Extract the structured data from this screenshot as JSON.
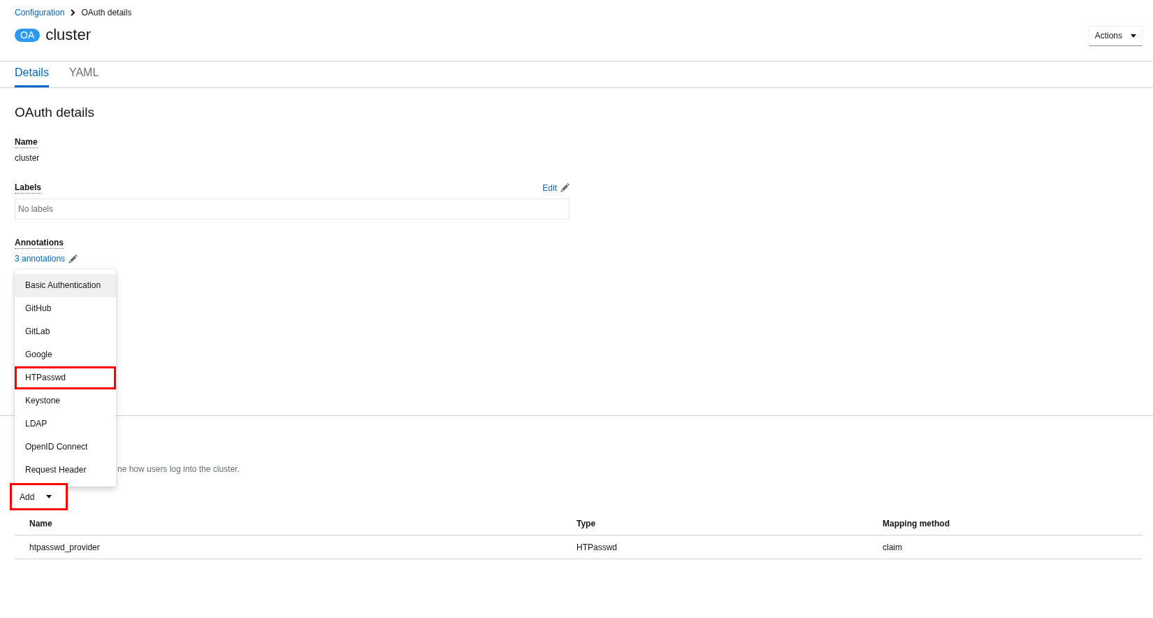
{
  "breadcrumb": [
    {
      "label": "Configuration",
      "kind": "link"
    },
    {
      "label": "OAuth details",
      "kind": "current"
    }
  ],
  "header": {
    "badge": "OA",
    "title": "cluster",
    "actions_button": "Actions"
  },
  "tabs": [
    {
      "label": "Details",
      "selected": true
    },
    {
      "label": "YAML",
      "selected": false
    }
  ],
  "details": {
    "heading": "OAuth details",
    "fields": [
      {
        "kind": "text",
        "label": "Name",
        "value": "cluster"
      },
      {
        "kind": "labels",
        "label": "Labels",
        "edit": "Edit",
        "value": "No labels"
      },
      {
        "kind": "link",
        "label": "Annotations",
        "value": "3 annotations"
      }
    ]
  },
  "identity_providers": {
    "description": "ne how users log into the cluster.",
    "add_button": {
      "label": "Add",
      "highlighted": true
    },
    "add_menu": {
      "items": [
        {
          "label": "Basic Authentication",
          "focused": true,
          "highlighted": false
        },
        {
          "label": "GitHub",
          "focused": false,
          "highlighted": false
        },
        {
          "label": "GitLab",
          "focused": false,
          "highlighted": false
        },
        {
          "label": "Google",
          "focused": false,
          "highlighted": false
        },
        {
          "label": "HTPasswd",
          "focused": false,
          "highlighted": true
        },
        {
          "label": "Keystone",
          "focused": false,
          "highlighted": false
        },
        {
          "label": "LDAP",
          "focused": false,
          "highlighted": false
        },
        {
          "label": "OpenID Connect",
          "focused": false,
          "highlighted": false
        },
        {
          "label": "Request Header",
          "focused": false,
          "highlighted": false
        }
      ]
    },
    "table": {
      "columns": [
        "Name",
        "Type",
        "Mapping method"
      ],
      "rows": [
        [
          "htpasswd_provider",
          "HTPasswd",
          "claim"
        ]
      ]
    }
  }
}
